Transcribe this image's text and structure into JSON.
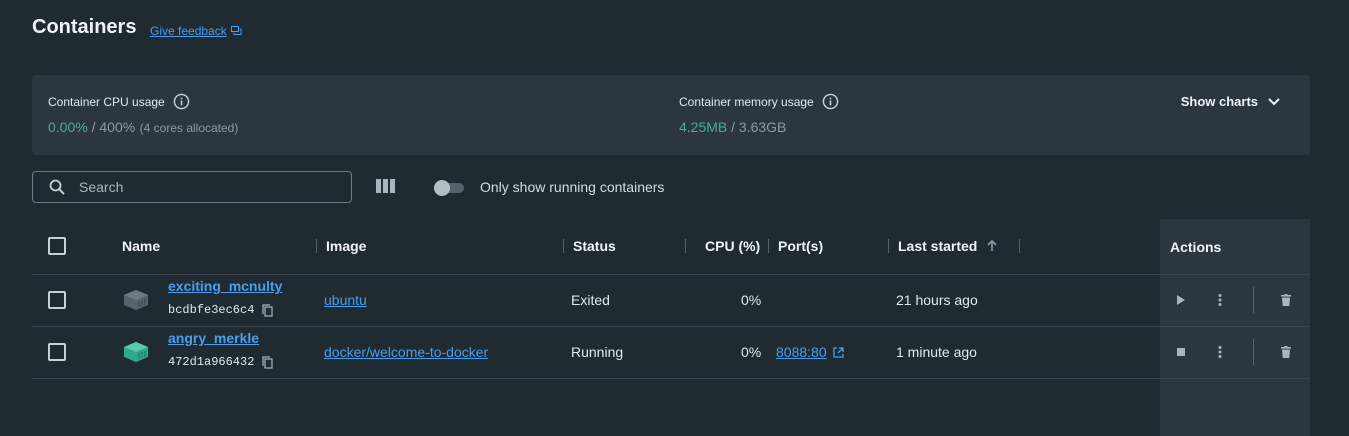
{
  "header": {
    "title": "Containers",
    "feedback_label": "Give feedback"
  },
  "stats": {
    "cpu": {
      "label": "Container CPU usage",
      "used": "0.00%",
      "total": "400%",
      "separator": " / ",
      "note": "(4 cores allocated)"
    },
    "memory": {
      "label": "Container memory usage",
      "used": "4.25MB",
      "total": "3.63GB",
      "separator": " / "
    },
    "show_charts_label": "Show charts"
  },
  "toolbar": {
    "search_placeholder": "Search",
    "running_toggle_label": "Only show running containers",
    "running_toggle_on": false
  },
  "table": {
    "columns": {
      "name": "Name",
      "image": "Image",
      "status": "Status",
      "cpu": "CPU (%)",
      "ports": "Port(s)",
      "last_started": "Last started",
      "actions": "Actions"
    },
    "rows": [
      {
        "name": "exciting_mcnulty",
        "id": "bcdbfe3ec6c4",
        "image": "ubuntu",
        "status": "Exited",
        "cpu": "0%",
        "port": "",
        "last_started": "21 hours ago",
        "running": false,
        "icon_color": "#56636d"
      },
      {
        "name": "angry_merkle",
        "id": "472d1a966432",
        "image": "docker/welcome-to-docker",
        "status": "Running",
        "cpu": "0%",
        "port": "8088:80",
        "last_started": "1 minute ago",
        "running": true,
        "icon_color": "#2ea88a"
      }
    ]
  },
  "colors": {
    "background": "#202a31",
    "panel": "#2b363f",
    "accent_link": "#4a9ef0",
    "stat_green": "#48b08e"
  },
  "icons": {
    "search": "search-icon",
    "columns": "columns-icon",
    "info": "info-icon",
    "chevron": "chevron-down-icon",
    "sort": "arrow-up-icon",
    "copy": "copy-icon",
    "external": "external-link-icon",
    "start": "play-icon",
    "stop": "stop-icon",
    "menu": "kebab-menu-icon",
    "delete": "trash-icon"
  }
}
